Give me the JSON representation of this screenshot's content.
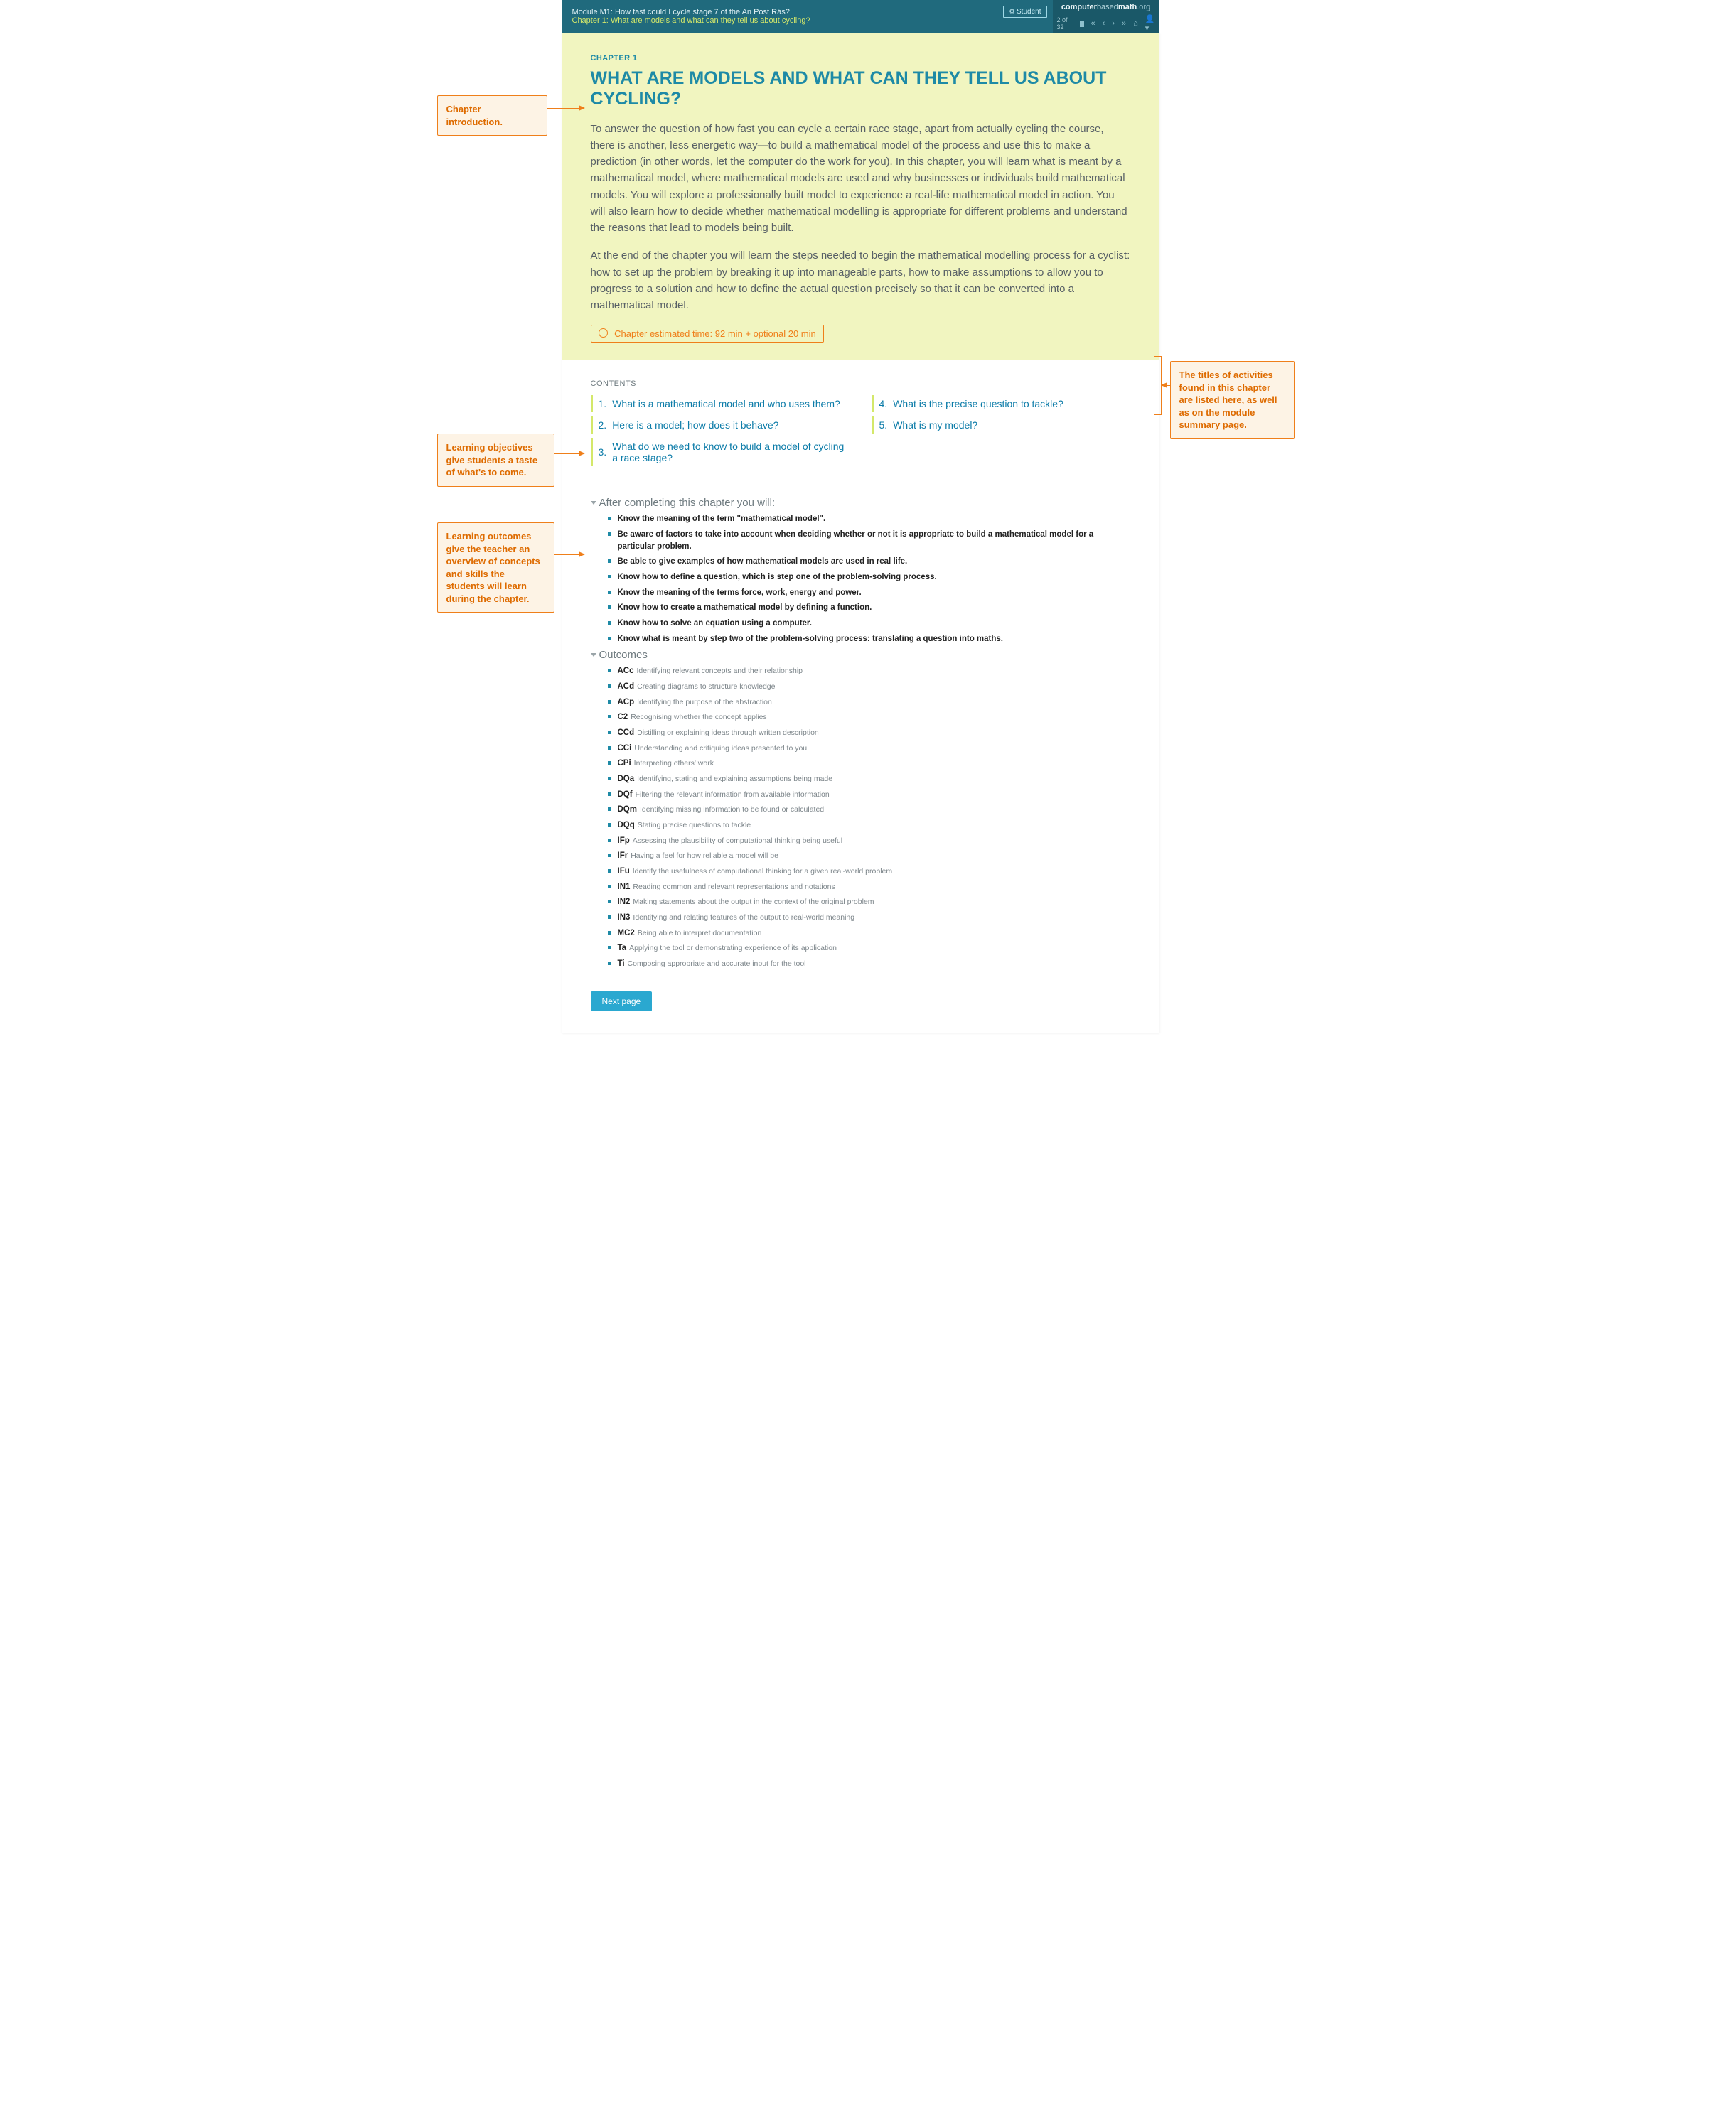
{
  "header": {
    "module": "Module M1: How fast could I cycle stage 7 of the An Post Rás?",
    "chapter_line": "Chapter 1: What are models and what can they tell us about cycling?",
    "student_btn": "Student",
    "brand_bold1": "computer",
    "brand_thin": "based",
    "brand_bold2": "math",
    "brand_org": ".org",
    "page_indicator": "2 of 32"
  },
  "hero": {
    "chapter_label": "CHAPTER 1",
    "title": "WHAT ARE MODELS AND WHAT CAN THEY TELL US ABOUT CYCLING?",
    "p1": "To answer the question of how fast you can cycle a certain race stage, apart from actually cycling the course, there is another, less energetic way—to build a mathematical model of the process and use this to make a prediction (in other words, let the computer do the work for you). In this chapter, you will learn what is meant by a mathematical model, where mathematical models are used and why businesses or individuals build mathematical models. You will explore a professionally built model to experience a real-life mathematical model in action. You will also learn how to decide whether mathematical modelling is appropriate for different problems and understand the reasons that lead to models being built.",
    "p2": "At the end of the chapter you will learn the steps needed to begin the mathematical modelling process for a cyclist: how to set up the problem by breaking it up into manageable parts, how to make assumptions to allow you to progress to a solution and how to define the actual question precisely so that it can be converted into a mathematical model.",
    "time": "Chapter estimated time: 92 min + optional 20 min"
  },
  "contents": {
    "label": "CONTENTS",
    "items": [
      {
        "n": "1.",
        "t": "What is a mathematical model and who uses them?"
      },
      {
        "n": "2.",
        "t": "Here is a model; how does it behave?"
      },
      {
        "n": "3.",
        "t": "What do we need to know to build a model of cycling a race stage?"
      },
      {
        "n": "4.",
        "t": "What is the precise question to tackle?"
      },
      {
        "n": "5.",
        "t": "What is my model?"
      }
    ]
  },
  "objectives": {
    "head": "After completing this chapter you will:",
    "items": [
      "Know the meaning of the term \"mathematical model\".",
      "Be aware of factors to take into account when deciding whether or not it is appropriate to build a mathematical model for a particular problem.",
      "Be able to give examples of how mathematical models are used in real life.",
      "Know how to define a question, which is step one of the problem-solving process.",
      "Know the meaning of the terms force, work, energy and power.",
      "Know how to create a mathematical model by defining a function.",
      "Know how to solve an equation using a computer.",
      "Know what is meant by step two of the problem-solving process: translating a question into maths."
    ]
  },
  "outcomes": {
    "head": "Outcomes",
    "items": [
      {
        "code": "ACc",
        "desc": "Identifying relevant concepts and their relationship"
      },
      {
        "code": "ACd",
        "desc": "Creating diagrams to structure knowledge"
      },
      {
        "code": "ACp",
        "desc": "Identifying the purpose of the abstraction"
      },
      {
        "code": "C2",
        "desc": "Recognising whether the concept applies"
      },
      {
        "code": "CCd",
        "desc": "Distilling or explaining ideas through written description"
      },
      {
        "code": "CCi",
        "desc": "Understanding and critiquing ideas presented to you"
      },
      {
        "code": "CPi",
        "desc": "Interpreting others' work"
      },
      {
        "code": "DQa",
        "desc": "Identifying, stating and explaining assumptions being made"
      },
      {
        "code": "DQf",
        "desc": "Filtering the relevant information from available information"
      },
      {
        "code": "DQm",
        "desc": "Identifying missing information to be found or calculated"
      },
      {
        "code": "DQq",
        "desc": "Stating precise questions to tackle"
      },
      {
        "code": "IFp",
        "desc": "Assessing the plausibility of computational thinking being useful"
      },
      {
        "code": "IFr",
        "desc": "Having a feel for how reliable a model will be"
      },
      {
        "code": "IFu",
        "desc": "Identify the usefulness of computational thinking for a given real-world problem"
      },
      {
        "code": "IN1",
        "desc": "Reading common and relevant representations and notations"
      },
      {
        "code": "IN2",
        "desc": "Making statements about the output in the context of the original problem"
      },
      {
        "code": "IN3",
        "desc": "Identifying and relating features of the output to real-world meaning"
      },
      {
        "code": "MC2",
        "desc": "Being able to interpret documentation"
      },
      {
        "code": "Ta",
        "desc": "Applying the tool or demonstrating experience of its application"
      },
      {
        "code": "Ti",
        "desc": "Composing appropriate and accurate input for the tool"
      }
    ]
  },
  "next_page": "Next page",
  "callouts": {
    "intro": "Chapter introduction.",
    "contents": "The titles of activities found in this chapter are listed here, as well as on the module summary page.",
    "objectives": "Learning objectives give students a taste of what's to come.",
    "outcomes": "Learning outcomes give the teacher an overview of concepts and skills the students will learn during the chapter."
  }
}
